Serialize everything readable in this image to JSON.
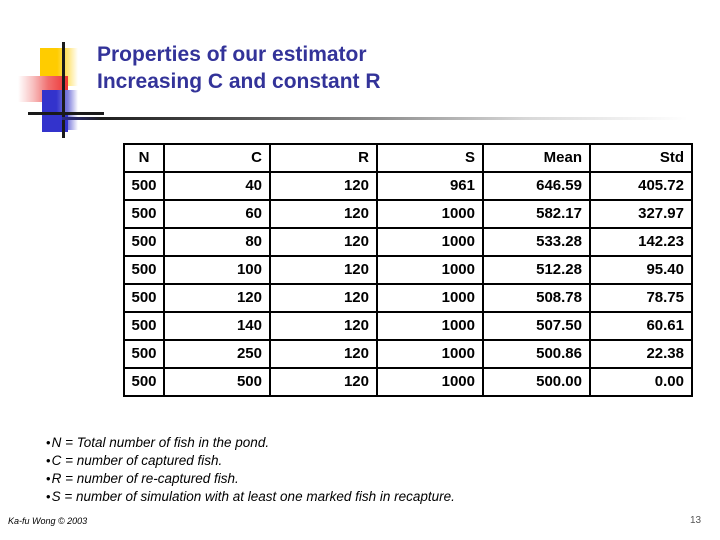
{
  "slide": {
    "title_line1": "Properties of our estimator",
    "title_line2": "Increasing C and constant R",
    "title_color": "#333399"
  },
  "table": {
    "headers": [
      "N",
      "C",
      "R",
      "S",
      "Mean",
      "Std"
    ],
    "rows": [
      [
        "500",
        "40",
        "120",
        "961",
        "646.59",
        "405.72"
      ],
      [
        "500",
        "60",
        "120",
        "1000",
        "582.17",
        "327.97"
      ],
      [
        "500",
        "80",
        "120",
        "1000",
        "533.28",
        "142.23"
      ],
      [
        "500",
        "100",
        "120",
        "1000",
        "512.28",
        "95.40"
      ],
      [
        "500",
        "120",
        "120",
        "1000",
        "508.78",
        "78.75"
      ],
      [
        "500",
        "140",
        "120",
        "1000",
        "507.50",
        "60.61"
      ],
      [
        "500",
        "250",
        "120",
        "1000",
        "500.86",
        "22.38"
      ],
      [
        "500",
        "500",
        "120",
        "1000",
        "500.00",
        "0.00"
      ]
    ]
  },
  "notes": {
    "bullet": "•",
    "items": [
      "N = Total number of fish in the pond.",
      "C = number of captured fish.",
      "R = number of re-captured fish.",
      "S = number of simulation with at least one marked fish in recapture."
    ]
  },
  "footer": {
    "credit": "Ka-fu Wong © 2003",
    "page_number": "13"
  }
}
